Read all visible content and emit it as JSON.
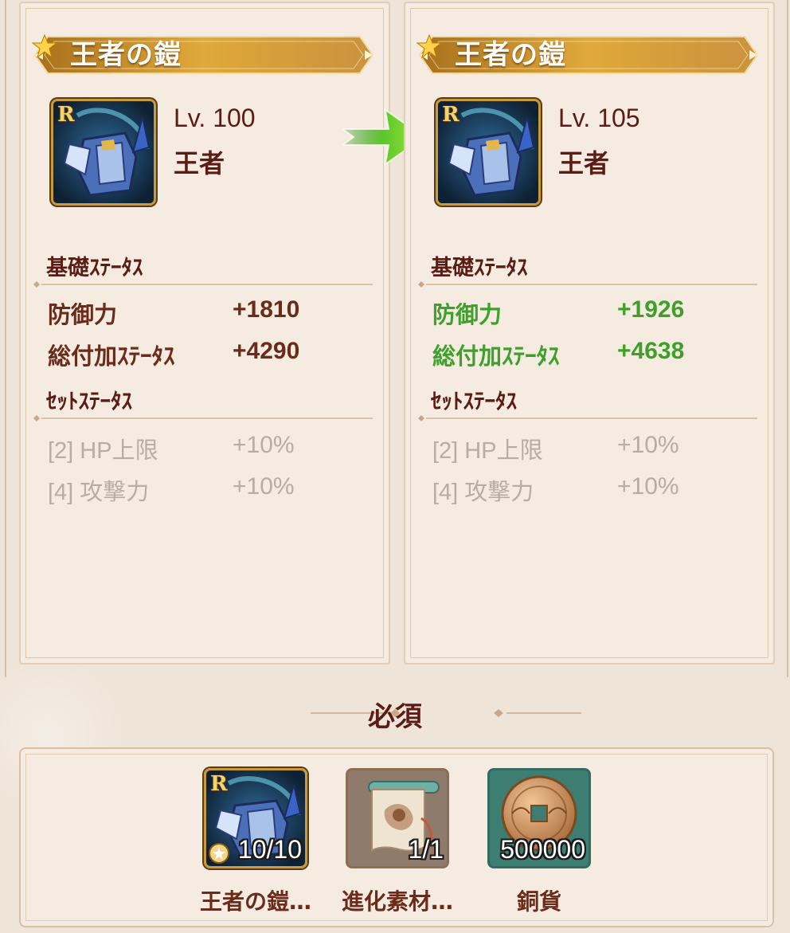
{
  "left_card": {
    "title": "王者の鎧",
    "rarity": "R",
    "level": "Lv. 100",
    "set_name": "王者",
    "base_section": "基礎ｽﾃｰﾀｽ",
    "base_stats": [
      {
        "label": "防御力",
        "value": "+1810"
      },
      {
        "label": "総付加ｽﾃｰﾀｽ",
        "value": "+4290"
      }
    ],
    "set_section": "ｾｯﾄｽﾃｰﾀｽ",
    "set_stats": [
      {
        "label": "[2] HP上限",
        "value": "+10%"
      },
      {
        "label": "[4] 攻撃力",
        "value": "+10%"
      }
    ]
  },
  "right_card": {
    "title": "王者の鎧",
    "rarity": "R",
    "level": "Lv. 105",
    "set_name": "王者",
    "base_section": "基礎ｽﾃｰﾀｽ",
    "base_stats": [
      {
        "label": "防御力",
        "value": "+1926"
      },
      {
        "label": "総付加ｽﾃｰﾀｽ",
        "value": "+4638"
      }
    ],
    "set_section": "ｾｯﾄｽﾃｰﾀｽ",
    "set_stats": [
      {
        "label": "[2] HP上限",
        "value": "+10%"
      },
      {
        "label": "[4] 攻撃力",
        "value": "+10%"
      }
    ]
  },
  "required": {
    "title": "必須",
    "materials": [
      {
        "name": "王者の鎧…",
        "count": "10/10",
        "rarity": "R",
        "icon": "armor-icon"
      },
      {
        "name": "進化素材…",
        "count": "1/1",
        "icon": "scroll-icon"
      },
      {
        "name": "銅貨",
        "count": "500000",
        "icon": "copper-coin-icon"
      }
    ]
  },
  "colors": {
    "stat_increase": "#3ea02a",
    "text_dark": "#5a1c14",
    "text_disabled": "#b9aca2",
    "banner_gold": "#c88a1c"
  }
}
